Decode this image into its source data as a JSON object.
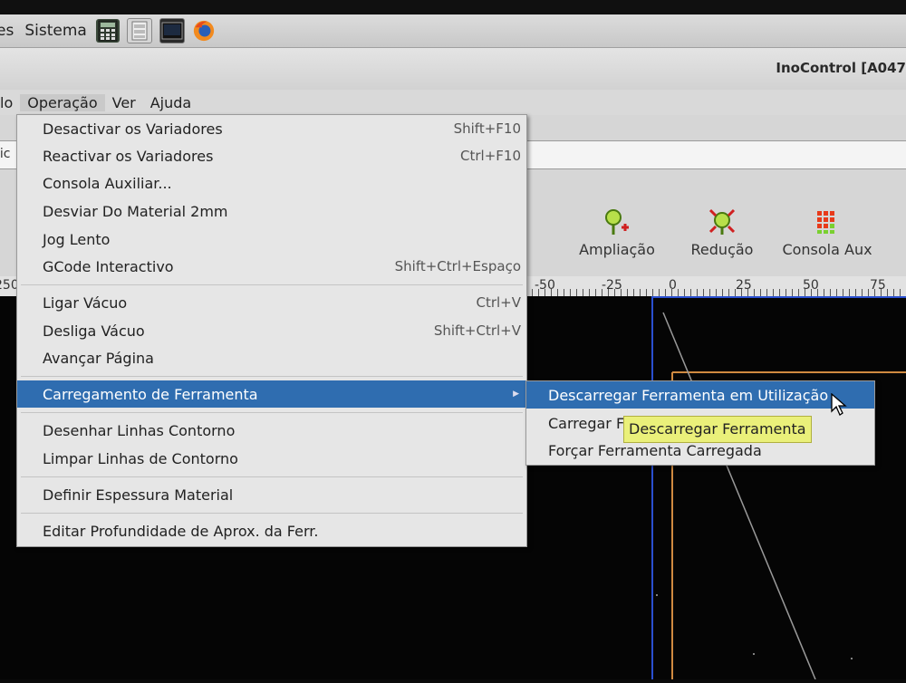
{
  "system_panel": {
    "menu_fragment": "es",
    "menu_sistema": "Sistema",
    "launchers": [
      "calculator-icon",
      "file-manager-icon",
      "terminal-icon",
      "firefox-icon"
    ]
  },
  "window": {
    "title": "InoControl [A047"
  },
  "menubar": {
    "items": [
      "lo",
      "Operação",
      "Ver",
      "Ajuda"
    ]
  },
  "address_fragment": "lic",
  "toolbar": {
    "buttons": [
      {
        "label": "Ampliação",
        "icon": "zoom-in-icon"
      },
      {
        "label": "Redução",
        "icon": "zoom-out-icon"
      },
      {
        "label": "Consola Aux",
        "icon": "grid-icon"
      }
    ]
  },
  "ruler": {
    "left_label": "250",
    "ticks": [
      "-50",
      "-25",
      "0",
      "25",
      "50",
      "75"
    ]
  },
  "dropdown": {
    "items": [
      {
        "label": "Desactivar os Variadores",
        "shortcut": "Shift+F10"
      },
      {
        "label": "Reactivar os Variadores",
        "shortcut": "Ctrl+F10"
      },
      {
        "label": "Consola Auxiliar...",
        "shortcut": ""
      },
      {
        "label": "Desviar Do Material 2mm",
        "shortcut": ""
      },
      {
        "label": "Jog Lento",
        "shortcut": ""
      },
      {
        "label": "GCode Interactivo",
        "shortcut": "Shift+Ctrl+Espaço"
      },
      {
        "label": "Ligar Vácuo",
        "shortcut": "Ctrl+V"
      },
      {
        "label": "Desliga Vácuo",
        "shortcut": "Shift+Ctrl+V"
      },
      {
        "label": "Avançar Página",
        "shortcut": ""
      },
      {
        "label": "Carregamento de Ferramenta",
        "shortcut": ""
      },
      {
        "label": "Desenhar Linhas Contorno",
        "shortcut": ""
      },
      {
        "label": "Limpar Linhas de Contorno",
        "shortcut": ""
      },
      {
        "label": "Definir Espessura Material",
        "shortcut": ""
      },
      {
        "label": "Editar Profundidade de Aprox. da Ferr.",
        "shortcut": ""
      }
    ]
  },
  "submenu": {
    "items": [
      "Descarregar Ferramenta em Utilização",
      "Carregar F",
      "Forçar Ferramenta Carregada"
    ]
  },
  "tooltip": "Descarregar Ferramenta",
  "colors": {
    "highlight": "#2f6db0",
    "tooltip_bg": "#eaf07a",
    "canvas_bg": "#050505",
    "frame_blue": "#2a4fd0",
    "frame_orange": "#d08a40"
  }
}
